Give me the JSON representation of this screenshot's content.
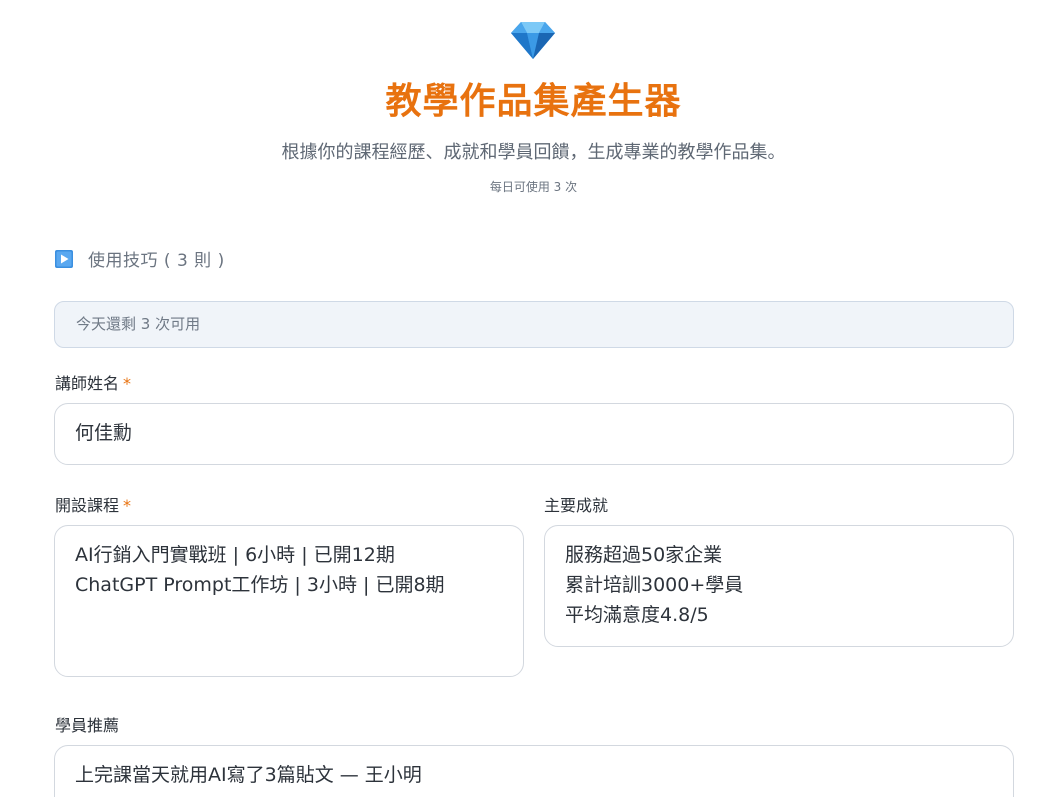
{
  "header": {
    "logo_icon": "diamond-icon",
    "title": "教學作品集產生器",
    "subtitle": "根據你的課程經歷、成就和學員回饋，生成專業的教學作品集。",
    "daily_limit": "每日可使用 3 次"
  },
  "tips": {
    "icon": "play-icon",
    "label": "使用技巧 ( 3 則 )"
  },
  "remaining": "今天還剩 3 次可用",
  "form": {
    "instructor_name": {
      "label": "講師姓名",
      "required_mark": "*",
      "value": "何佳勳"
    },
    "courses": {
      "label": "開設課程",
      "required_mark": "*",
      "value": "AI行銷入門實戰班 | 6小時 | 已開12期\nChatGPT Prompt工作坊 | 3小時 | 已開8期"
    },
    "achievements": {
      "label": "主要成就",
      "value": "服務超過50家企業\n累計培訓3000+學員\n平均滿意度4.8/5"
    },
    "testimonials": {
      "label": "學員推薦",
      "value": "上完課當天就用AI寫了3篇貼文 — 王小明"
    }
  },
  "colors": {
    "accent": "#e8720f",
    "notice_bg": "#f0f4f9",
    "border": "#d3d8df"
  }
}
